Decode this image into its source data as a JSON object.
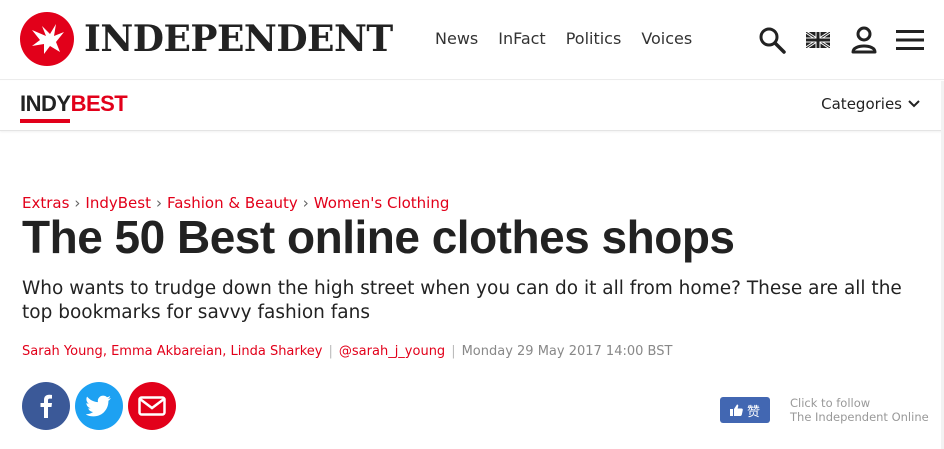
{
  "header": {
    "logo_text": "INDEPENDENT",
    "nav": [
      "News",
      "InFact",
      "Politics",
      "Voices"
    ],
    "icons": [
      "search-icon",
      "uk-flag-icon",
      "user-icon",
      "menu-icon"
    ]
  },
  "section": {
    "indy": "INDY",
    "best": "BEST",
    "categories_label": "Categories"
  },
  "article": {
    "breadcrumb": [
      "Extras",
      "IndyBest",
      "Fashion & Beauty",
      "Women's Clothing"
    ],
    "title": "The 50 Best online clothes shops",
    "standfirst": "Who wants to trudge down the high street when you can do it all from home? These are all the top bookmarks for savvy fashion fans",
    "authors": [
      "Sarah Young",
      "Emma Akbareian",
      "Linda Sharkey"
    ],
    "twitter_handle": "@sarah_j_young",
    "date": "Monday 29 May 2017 14:00 BST"
  },
  "share": {
    "like_label": "赞",
    "follow_line1": "Click to follow",
    "follow_line2": "The Independent Online"
  },
  "colors": {
    "brand_red": "#e2001a",
    "facebook": "#3b5998",
    "twitter": "#1da1f2",
    "like": "#4267b2"
  }
}
